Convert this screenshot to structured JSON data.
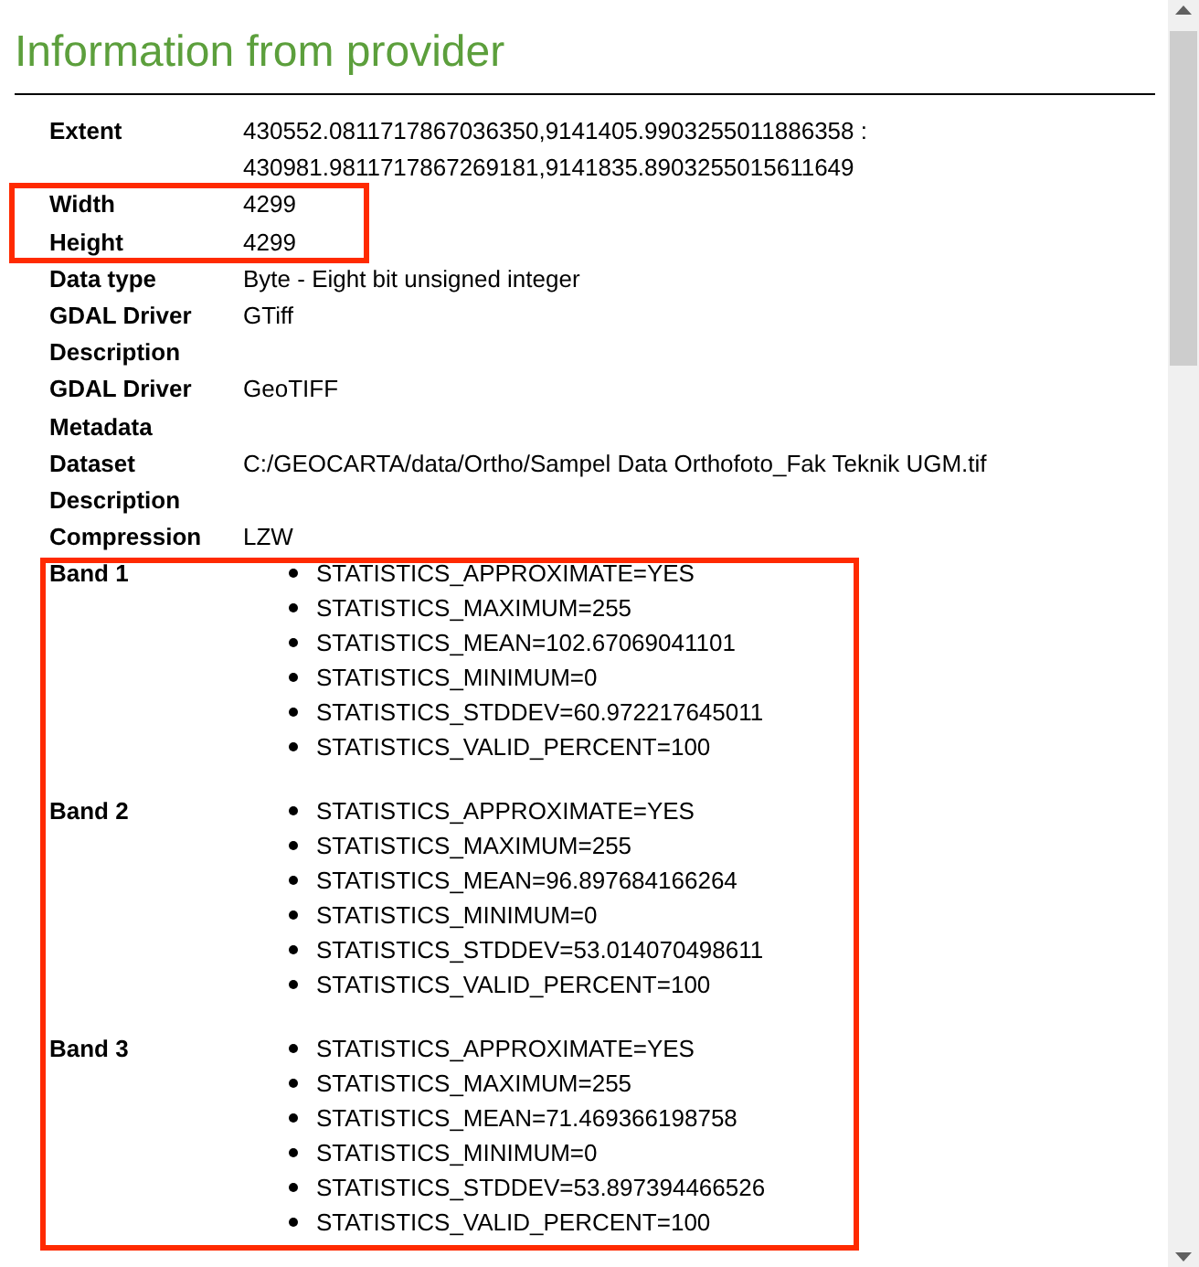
{
  "heading": "Information from provider",
  "sections": [
    {
      "highlighted": false,
      "rows": [
        {
          "label": "Extent",
          "value": "430552.0811717867036350,9141405.9903255011886358 : 430981.9811717867269181,9141835.8903255015611649"
        }
      ]
    },
    {
      "highlighted": true,
      "rows": [
        {
          "label": "Width",
          "value": "4299"
        },
        {
          "label": "Height",
          "value": "4299"
        }
      ]
    },
    {
      "highlighted": false,
      "rows": [
        {
          "label": "Data type",
          "value": "Byte - Eight bit unsigned integer"
        },
        {
          "label": "GDAL Driver Description",
          "value": "GTiff"
        },
        {
          "label": "GDAL Driver Metadata",
          "value": "GeoTIFF"
        },
        {
          "label": "Dataset Description",
          "value": "C:/GEOCARTA/data/Ortho/Sampel Data Orthofoto_Fak Teknik UGM.tif"
        },
        {
          "label": "Compression",
          "value": "LZW"
        }
      ]
    },
    {
      "highlighted": true,
      "rows": [
        {
          "label": "Band 1",
          "items": [
            "STATISTICS_APPROXIMATE=YES",
            "STATISTICS_MAXIMUM=255",
            "STATISTICS_MEAN=102.67069041101",
            "STATISTICS_MINIMUM=0",
            "STATISTICS_STDDEV=60.972217645011",
            "STATISTICS_VALID_PERCENT=100"
          ]
        },
        {
          "label": "Band 2",
          "items": [
            "STATISTICS_APPROXIMATE=YES",
            "STATISTICS_MAXIMUM=255",
            "STATISTICS_MEAN=96.897684166264",
            "STATISTICS_MINIMUM=0",
            "STATISTICS_STDDEV=53.014070498611",
            "STATISTICS_VALID_PERCENT=100"
          ]
        },
        {
          "label": "Band 3",
          "items": [
            "STATISTICS_APPROXIMATE=YES",
            "STATISTICS_MAXIMUM=255",
            "STATISTICS_MEAN=71.469366198758",
            "STATISTICS_MINIMUM=0",
            "STATISTICS_STDDEV=53.897394466526",
            "STATISTICS_VALID_PERCENT=100"
          ]
        }
      ]
    }
  ]
}
